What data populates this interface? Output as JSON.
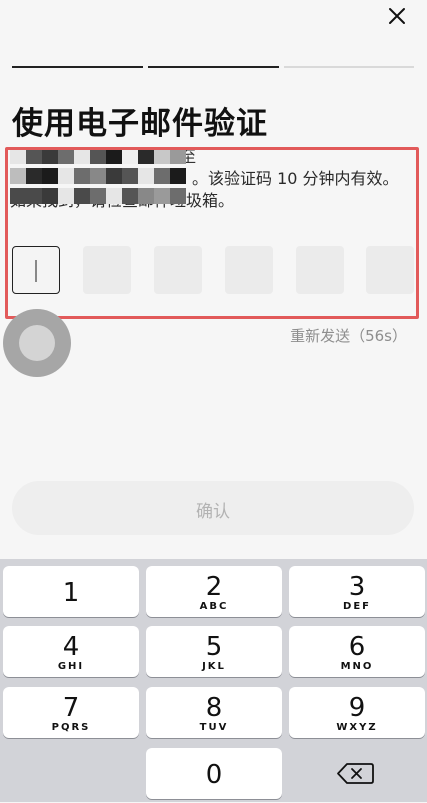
{
  "header": {
    "close_icon": "close-icon"
  },
  "title": "使用电子邮件验证",
  "description": {
    "line1": "我们已将6位验证码发送至",
    "line2_suffix": "。该验证码 10 分钟内有效。",
    "line3": "如果找到，请检查邮件垃圾箱。"
  },
  "code_boxes": [
    "",
    "",
    "",
    "",
    "",
    ""
  ],
  "resend": "重新发送（56s）",
  "confirm_button": "确认",
  "keyboard": {
    "keys": [
      {
        "num": "1",
        "letters": ""
      },
      {
        "num": "2",
        "letters": "ABC"
      },
      {
        "num": "3",
        "letters": "DEF"
      },
      {
        "num": "4",
        "letters": "GHI"
      },
      {
        "num": "5",
        "letters": "JKL"
      },
      {
        "num": "6",
        "letters": "MNO"
      },
      {
        "num": "7",
        "letters": "PQRS"
      },
      {
        "num": "8",
        "letters": "TUV"
      },
      {
        "num": "9",
        "letters": "WXYZ"
      },
      {
        "num": "0",
        "letters": ""
      }
    ],
    "delete_icon": "backspace-icon"
  },
  "colors": {
    "highlight": "#e25a5a",
    "text": "#111111",
    "muted": "#8e8e8e",
    "keyboard_bg": "#d2d3d8"
  }
}
